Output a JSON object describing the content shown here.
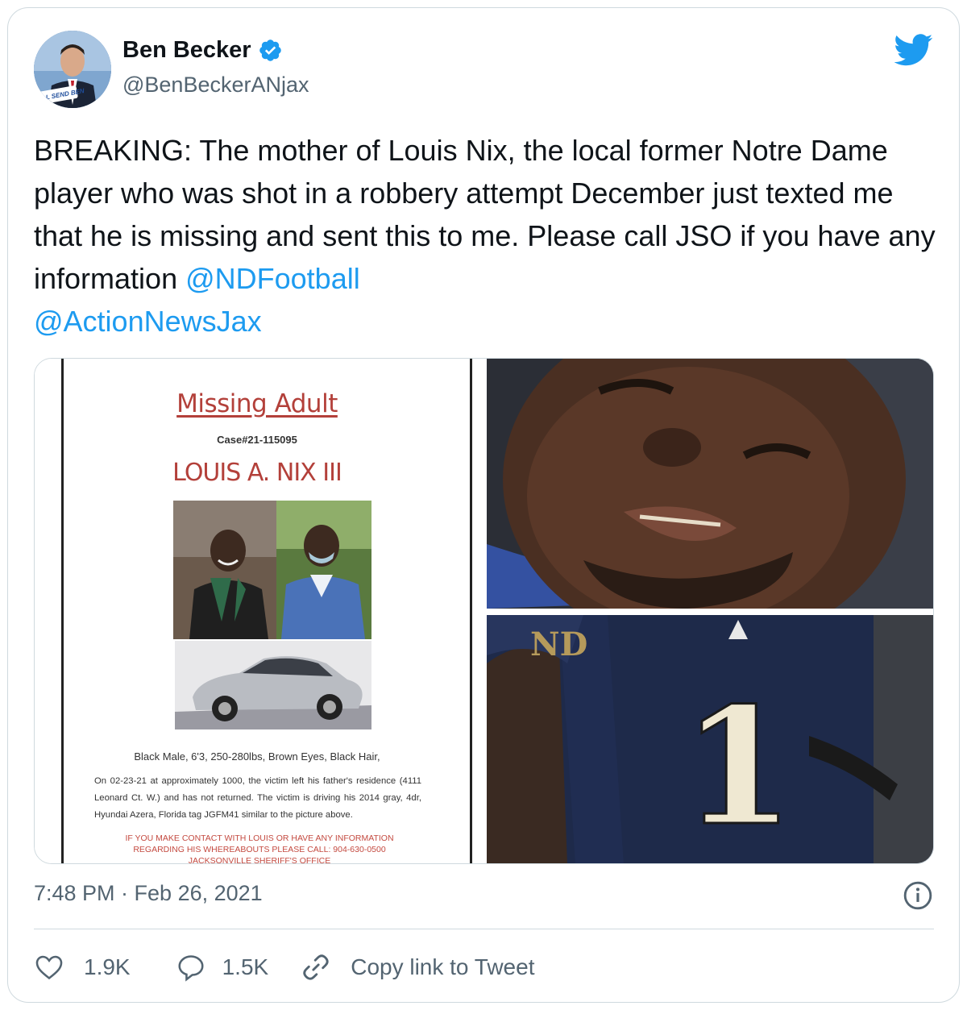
{
  "author": {
    "name": "Ben Becker",
    "handle": "@BenBeckerANjax",
    "avatar_badge": "WE'LL SEND BEN"
  },
  "tweet": {
    "text_plain": "BREAKING: The mother of Louis Nix, the local former Notre Dame player who was shot in a robbery attempt December just texted me that he is missing and sent this to me. Please call JSO if you have any information ",
    "mention_1": "@NDFootball",
    "mention_2": "@ActionNewsJax",
    "timestamp": "7:48 PM · Feb 26, 2021"
  },
  "poster": {
    "title": "Missing Adult",
    "case": "Case#21-115095",
    "name": "LOUIS A. NIX III",
    "description": "Black Male, 6'3, 250-280lbs, Brown Eyes, Black Hair,",
    "body": "On 02-23-21 at approximately 1000, the victim left his father's residence (4111 Leonard Ct. W.) and has not returned. The victim is driving his 2014 gray, 4dr, Hyundai Azera, Florida tag JGFM41 similar to the picture above.",
    "warning": "IF YOU MAKE CONTACT WITH LOUIS OR HAVE ANY INFORMATION REGARDING HIS WHEREABOUTS PLEASE CALL: 904-630-0500 JACKSONVILLE SHERIFF'S OFFICE"
  },
  "jersey_number": "1",
  "actions": {
    "likes": "1.9K",
    "replies": "1.5K",
    "copy_link": "Copy link to Tweet"
  },
  "colors": {
    "link": "#1d9bf0",
    "secondary_text": "#536471",
    "border": "#cfd9de",
    "poster_red": "#b3403a"
  },
  "icons": [
    "verified-badge-icon",
    "twitter-bird-icon",
    "info-icon",
    "heart-icon",
    "reply-icon",
    "link-icon"
  ]
}
